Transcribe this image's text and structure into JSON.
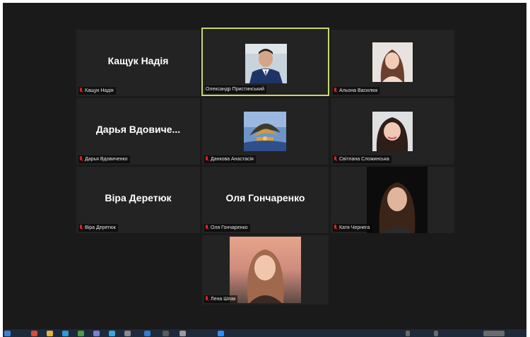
{
  "participants": [
    {
      "big_name": "Кащук Надія",
      "label": "Кащук Надія",
      "muted": true
    },
    {
      "big_name": "",
      "label": "Олександр Пристинський",
      "muted": false,
      "active_speaker": true
    },
    {
      "big_name": "",
      "label": "Альона Василюк",
      "muted": true
    },
    {
      "big_name": "Дарья  Вдовиче...",
      "label": "Дарья Вдовиченко",
      "muted": true
    },
    {
      "big_name": "",
      "label": "Данкова Анастасія",
      "muted": true
    },
    {
      "big_name": "",
      "label": "Світлана Сложинська",
      "muted": true
    },
    {
      "big_name": "Віра Деретюк",
      "label": "Віра Деретюк",
      "muted": true
    },
    {
      "big_name": "Оля Гончаренко",
      "label": "Оля Гончаренко",
      "muted": true
    },
    {
      "big_name": "",
      "label": "Катя Чернега",
      "muted": true
    },
    {
      "big_name": "",
      "label": "Лена Шпак",
      "muted": true
    }
  ],
  "colors": {
    "background": "#1a1a1a",
    "tile": "#232323",
    "active_border": "#c8d870",
    "muted_mic": "#e02020"
  }
}
